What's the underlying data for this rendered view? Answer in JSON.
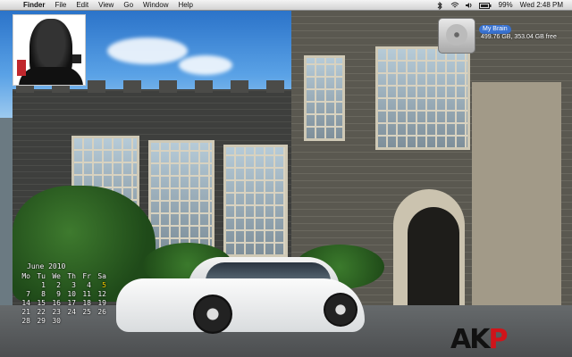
{
  "menubar": {
    "apple_glyph": "",
    "menus": [
      "Finder",
      "File",
      "Edit",
      "View",
      "Go",
      "Window",
      "Help"
    ],
    "active_app": "Finder",
    "battery": "99%",
    "clock": "Wed 2:48 PM"
  },
  "calendar": {
    "title": "June 2010",
    "weekdays": [
      "Mo",
      "Tu",
      "We",
      "Th",
      "Fr",
      "Sa"
    ],
    "weeks": [
      [
        "",
        "1",
        "2",
        "3",
        "4",
        "5"
      ],
      [
        "7",
        "8",
        "9",
        "10",
        "11",
        "12"
      ],
      [
        "14",
        "15",
        "16",
        "17",
        "18",
        "19"
      ],
      [
        "21",
        "22",
        "23",
        "24",
        "25",
        "26"
      ],
      [
        "28",
        "29",
        "30",
        "",
        "",
        ""
      ]
    ],
    "today": "5"
  },
  "drive": {
    "name": "My Brain",
    "info": "499.76 GB, 353.04 GB free",
    "icon": "hard-drive-icon"
  },
  "logo": {
    "left_text": "AK",
    "right_text": "P",
    "colors": {
      "left": "#111111",
      "right": "#d0141a"
    }
  },
  "album_art": {
    "icon": "album-cover"
  }
}
